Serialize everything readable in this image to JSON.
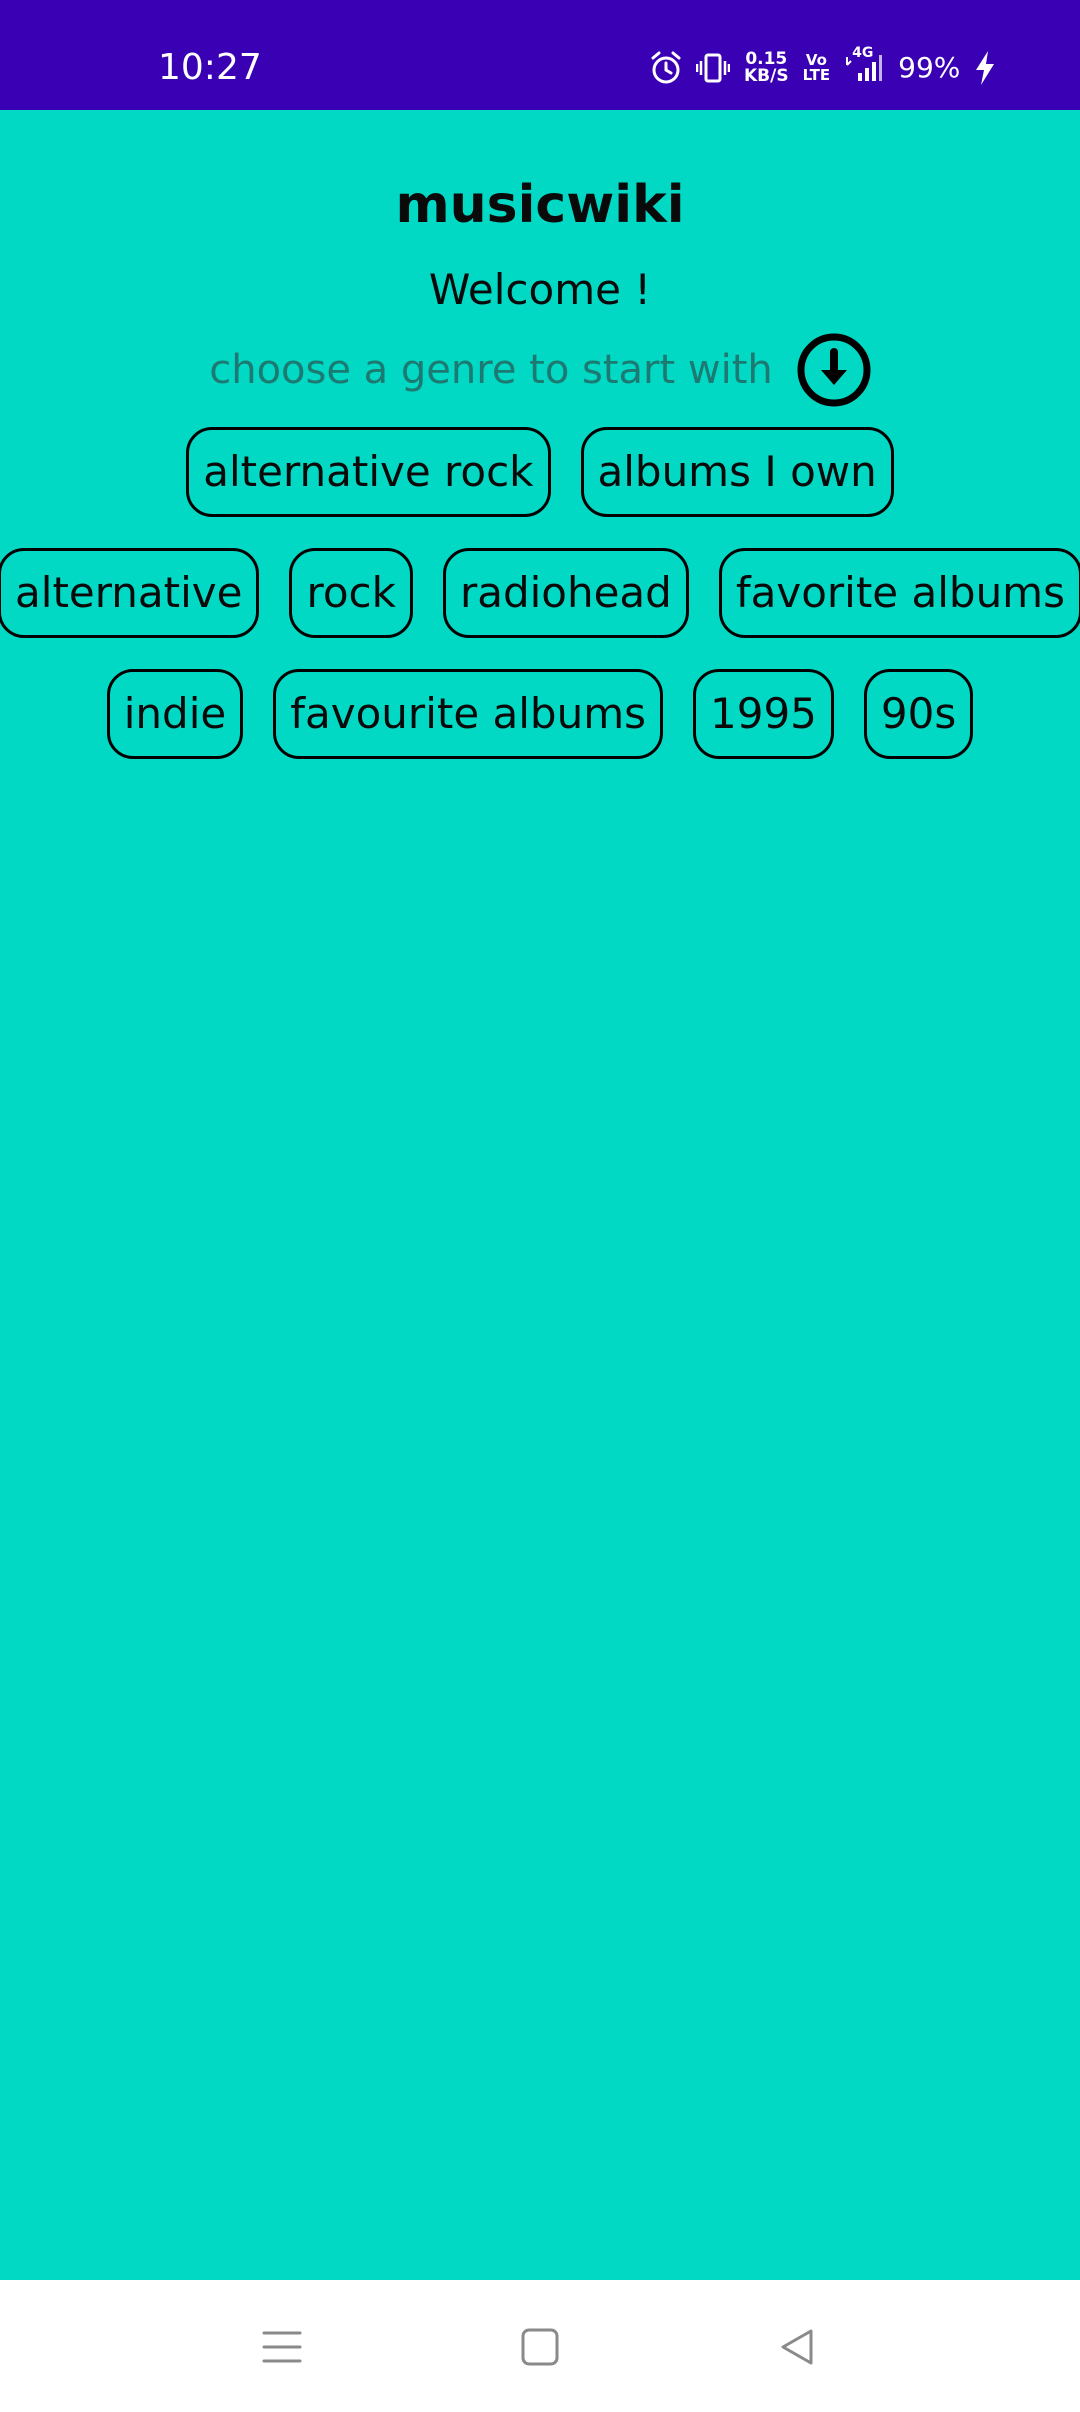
{
  "status_bar": {
    "time": "10:27",
    "net_speed_value": "0.15",
    "net_speed_unit": "KB/S",
    "volte_top": "Vo",
    "volte_bottom": "LTE",
    "network_type": "4G",
    "battery": "99%",
    "icons": [
      "alarm-icon",
      "vibrate-icon",
      "signal-icon",
      "charging-icon"
    ]
  },
  "header": {
    "title": "musicwiki",
    "welcome": "Welcome !",
    "subtitle": "choose a genre to start with",
    "expand_icon": "arrow-down-circle-icon"
  },
  "genres": {
    "rows": [
      [
        "alternative rock",
        "albums I own"
      ],
      [
        "alternative",
        "rock",
        "radiohead",
        "favorite albums"
      ],
      [
        "indie",
        "favourite albums",
        "1995",
        "90s"
      ]
    ]
  },
  "nav_bar": {
    "icons": [
      "menu-icon",
      "home-icon",
      "back-icon"
    ]
  },
  "colors": {
    "status_bar": "#3a00b3",
    "background": "#02d9c5",
    "nav_bar": "#ffffff"
  }
}
